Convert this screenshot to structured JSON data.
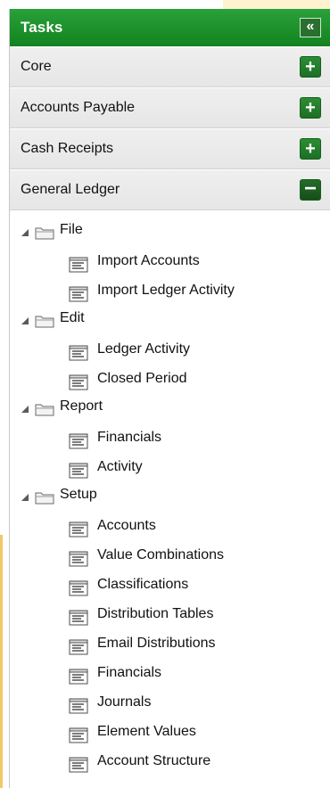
{
  "panel": {
    "title": "Tasks",
    "collapse_glyph": "«",
    "collapse_icon": "double-chevron-left-icon"
  },
  "sections": [
    {
      "label": "Core",
      "state": "+",
      "expanded": false
    },
    {
      "label": "Accounts Payable",
      "state": "+",
      "expanded": false
    },
    {
      "label": "Cash Receipts",
      "state": "+",
      "expanded": false
    },
    {
      "label": "General Ledger",
      "state": "−",
      "expanded": true
    }
  ],
  "tree": [
    {
      "label": "File",
      "icon": "folder-icon",
      "children": [
        "Import Accounts",
        "Import Ledger Activity"
      ]
    },
    {
      "label": "Edit",
      "icon": "folder-icon",
      "children": [
        "Ledger Activity",
        "Closed Period"
      ]
    },
    {
      "label": "Report",
      "icon": "folder-icon",
      "children": [
        "Financials",
        "Activity"
      ]
    },
    {
      "label": "Setup",
      "icon": "folder-icon",
      "children": [
        "Accounts",
        "Value Combinations",
        "Classifications",
        "Distribution Tables",
        "Email Distributions",
        "Financials",
        "Journals",
        "Element Values",
        "Account Structure"
      ]
    }
  ],
  "colors": {
    "header_green": "#1f8f2c",
    "button_green": "#1f7a2a",
    "section_bg": "#ebebeb"
  }
}
